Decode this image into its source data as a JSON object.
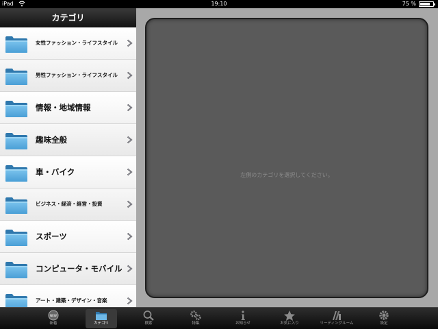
{
  "status_bar": {
    "carrier": "iPad",
    "time": "19:10",
    "battery": "75 %",
    "battery_level": 0.75
  },
  "sidebar": {
    "title": "カテゴリ",
    "items": [
      {
        "label": "女性ファッション・ライフスタイル",
        "size": "small"
      },
      {
        "label": "男性ファッション・ライフスタイル",
        "size": "small"
      },
      {
        "label": "情報・地域情報",
        "size": "large"
      },
      {
        "label": "趣味全般",
        "size": "large"
      },
      {
        "label": "車・バイク",
        "size": "large"
      },
      {
        "label": "ビジネス・経済・経営・投資",
        "size": "small"
      },
      {
        "label": "スポーツ",
        "size": "large"
      },
      {
        "label": "コンピュータ・モバイル",
        "size": "large"
      },
      {
        "label": "アート・建築・デザイン・音楽",
        "size": "small"
      }
    ]
  },
  "main": {
    "placeholder": "左側のカテゴリを選択してください。"
  },
  "tab_bar": {
    "tabs": [
      {
        "label": "新着",
        "icon": "new-icon",
        "badge": "NEW"
      },
      {
        "label": "カテゴリ",
        "icon": "folder-icon",
        "active": true
      },
      {
        "label": "検索",
        "icon": "search-icon"
      },
      {
        "label": "特集",
        "icon": "gears-icon"
      },
      {
        "label": "お知らせ",
        "icon": "info-icon"
      },
      {
        "label": "お気に入り",
        "icon": "star-icon"
      },
      {
        "label": "リーディングルーム",
        "icon": "books-icon"
      },
      {
        "label": "設定",
        "icon": "gear-icon"
      }
    ]
  },
  "colors": {
    "folder": "#4a9fd6",
    "panel": "#5a5a5a",
    "main_bg": "#a8a8a8"
  }
}
